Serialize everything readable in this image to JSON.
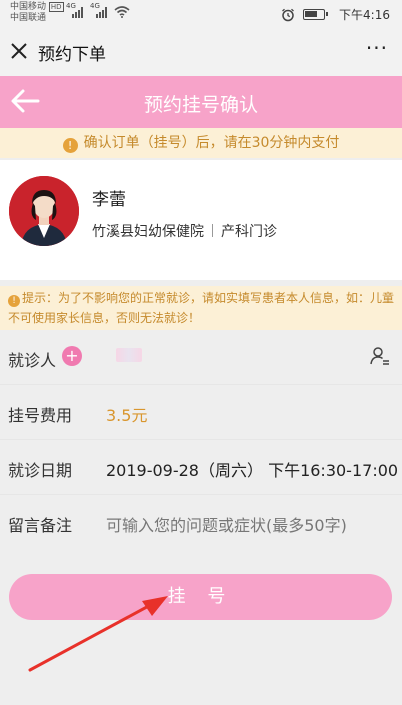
{
  "status_bar": {
    "carrier_1": "中国移动",
    "carrier_2": "中国联通",
    "net_1": "HD",
    "net_2": "4G",
    "net_3": "4G",
    "time": "下午4:16"
  },
  "wechat_nav": {
    "close_icon": "close-icon",
    "title": "预约下单",
    "more": "···"
  },
  "header": {
    "back_icon": "back-arrow-icon",
    "title": "预约挂号确认"
  },
  "notice": {
    "icon": "!",
    "text": "确认订单（挂号）后，请在30分钟内支付"
  },
  "doctor": {
    "name": "李蕾",
    "hospital": "竹溪县妇幼保健院",
    "department": "产科门诊"
  },
  "tip": {
    "icon": "!",
    "text": "提示：为了不影响您的正常就诊，请如实填写患者本人信息，如：儿童不可使用家长信息，否则无法就诊！"
  },
  "form": {
    "patient_label": "就诊人",
    "fee_label": "挂号费用",
    "fee_value": "3.5元",
    "date_label": "就诊日期",
    "date_value": "2019-09-28（周六） 下午16:30-17:00",
    "note_label": "留言备注",
    "note_placeholder": "可输入您的问题或症状(最多50字)"
  },
  "submit": {
    "label": "挂 号"
  },
  "colors": {
    "accent_pink": "#f7a3c9",
    "notice_bg": "#fcf0d6",
    "notice_text": "#c58a2c",
    "annotation_red": "#e8312a"
  }
}
